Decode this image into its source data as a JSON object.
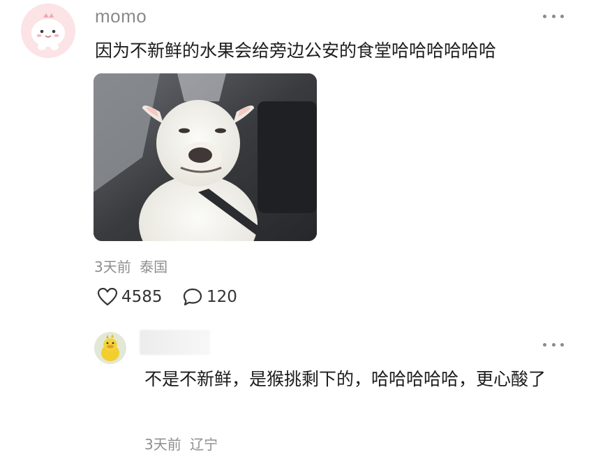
{
  "comment": {
    "username": "momo",
    "text": "因为不新鲜的水果会给旁边公安的食堂哈哈哈哈哈哈",
    "time": "3天前",
    "location": "泰国",
    "likes": "4585",
    "replies": "120"
  },
  "reply": {
    "text": "不是不新鲜，是猴挑剩下的，哈哈哈哈哈，更心酸了",
    "time": "3天前",
    "location": "辽宁"
  },
  "icons": {
    "more": "more-dots-icon",
    "like": "heart-outline-icon",
    "comment": "speech-bubble-icon"
  },
  "colors": {
    "text": "#1c1c1c",
    "muted": "#8e8e8e",
    "avatar_main_bg": "#fbe3e6"
  }
}
